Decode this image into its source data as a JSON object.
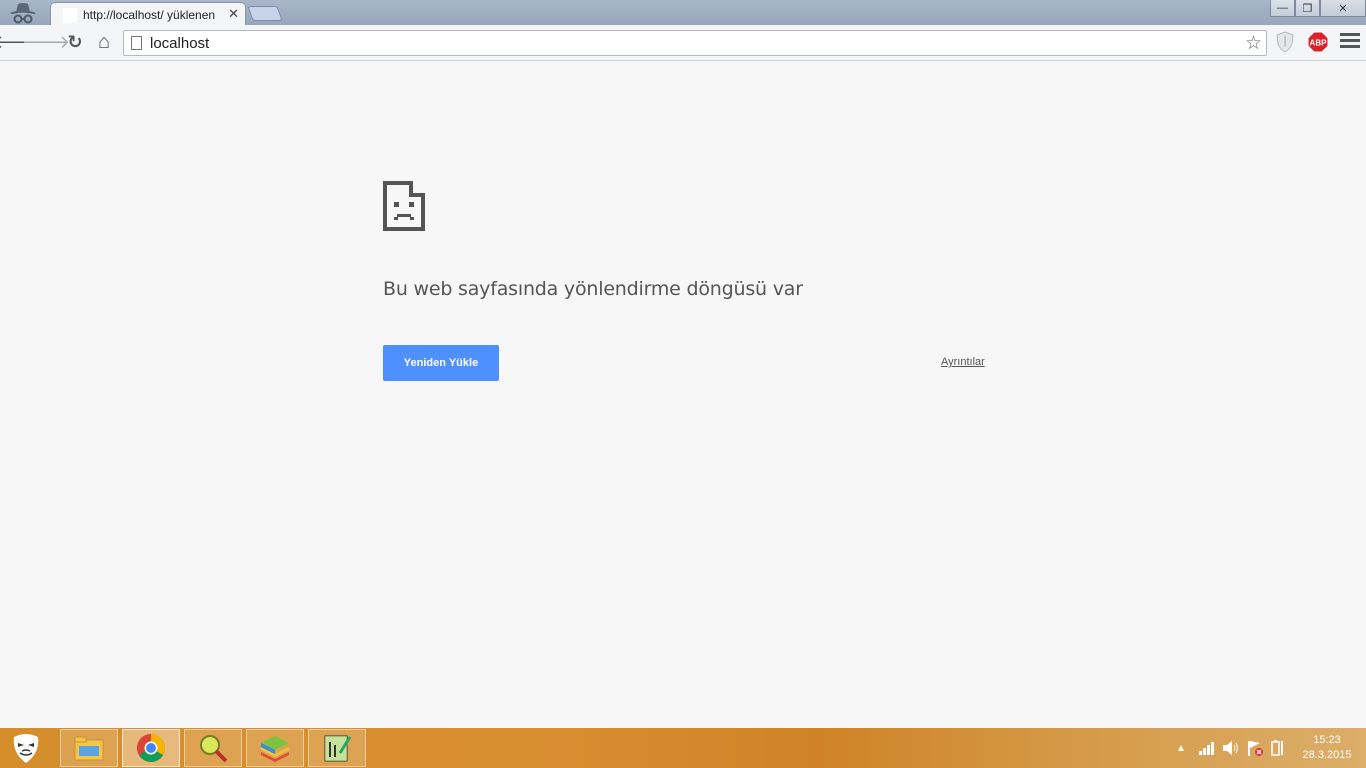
{
  "browser": {
    "tab": {
      "title": "http://localhost/ yüklenen",
      "close": "✕"
    },
    "window": {
      "minimize": "—",
      "restore": "❐",
      "close": "✕"
    },
    "toolbar": {
      "back": "🡐",
      "forward": "🡒",
      "reload": "↻",
      "home": "⌂",
      "url": "localhost",
      "star": "☆"
    },
    "extensions": {
      "abp_label": "ABP"
    }
  },
  "page": {
    "heading": "Bu web sayfasında yönlendirme döngüsü var",
    "reload_button": "Yeniden Yükle",
    "details_link": "Ayrıntılar"
  },
  "taskbar": {
    "items": [
      "file-explorer",
      "chrome",
      "search-tool",
      "bluestacks",
      "editor"
    ],
    "clock": {
      "time": "15:23",
      "date": "28.3.2015"
    }
  },
  "colors": {
    "accent": "#4d90fe",
    "taskbar": "#d68d2c",
    "page_bg": "#f7f7f7"
  }
}
